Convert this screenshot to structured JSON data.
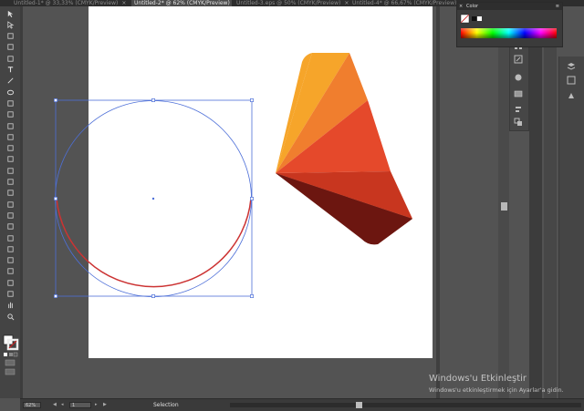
{
  "tabs": [
    {
      "label": "Untitled-1* @ 33,33% (CMYK/Preview)",
      "active": false
    },
    {
      "label": "Untitled-2* @ 62% (CMYK/Preview)",
      "active": true
    },
    {
      "label": "Untitled-3.eps @ 50% (CMYK/Preview)",
      "active": false
    },
    {
      "label": "Untitled-4* @ 66,67% (CMYK/Preview)",
      "active": false
    }
  ],
  "tab_close_glyph": "×",
  "tools": [
    "selection-tool",
    "direct-selection-tool",
    "magic-wand-tool",
    "lasso-tool",
    "pen-tool",
    "type-tool",
    "line-segment-tool",
    "ellipse-tool",
    "paintbrush-tool",
    "pencil-tool",
    "blob-brush-tool",
    "eraser-tool",
    "rotate-tool",
    "scale-tool",
    "width-tool",
    "free-transform-tool",
    "shape-builder-tool",
    "perspective-grid-tool",
    "mesh-tool",
    "gradient-tool",
    "eyedropper-tool",
    "blend-tool",
    "symbol-sprayer-tool",
    "column-graph-tool",
    "artboard-tool",
    "slice-tool",
    "hand-tool",
    "zoom-tool"
  ],
  "fill_color": "#ffffff",
  "stroke_color": "#cc3333",
  "color_panel": {
    "title": "Color",
    "close_glyph": "×",
    "menu_glyph": "≡"
  },
  "selection": {
    "stroke_color": "#4d6fd8"
  },
  "fan_colors": [
    "#f6a52a",
    "#f07e2e",
    "#e5492b",
    "#c8361f",
    "#a02d19",
    "#6c1610"
  ],
  "status": {
    "zoom": "62%",
    "page": "1",
    "tool_label": "Selection",
    "arrow_first": "◀",
    "arrow_prev": "◂",
    "arrow_next": "▸",
    "arrow_last": "▶"
  },
  "watermark": {
    "title": "Windows'u Etkinleştir",
    "subtitle": "Windows'u etkinleştirmek için Ayarlar'a gidin."
  }
}
